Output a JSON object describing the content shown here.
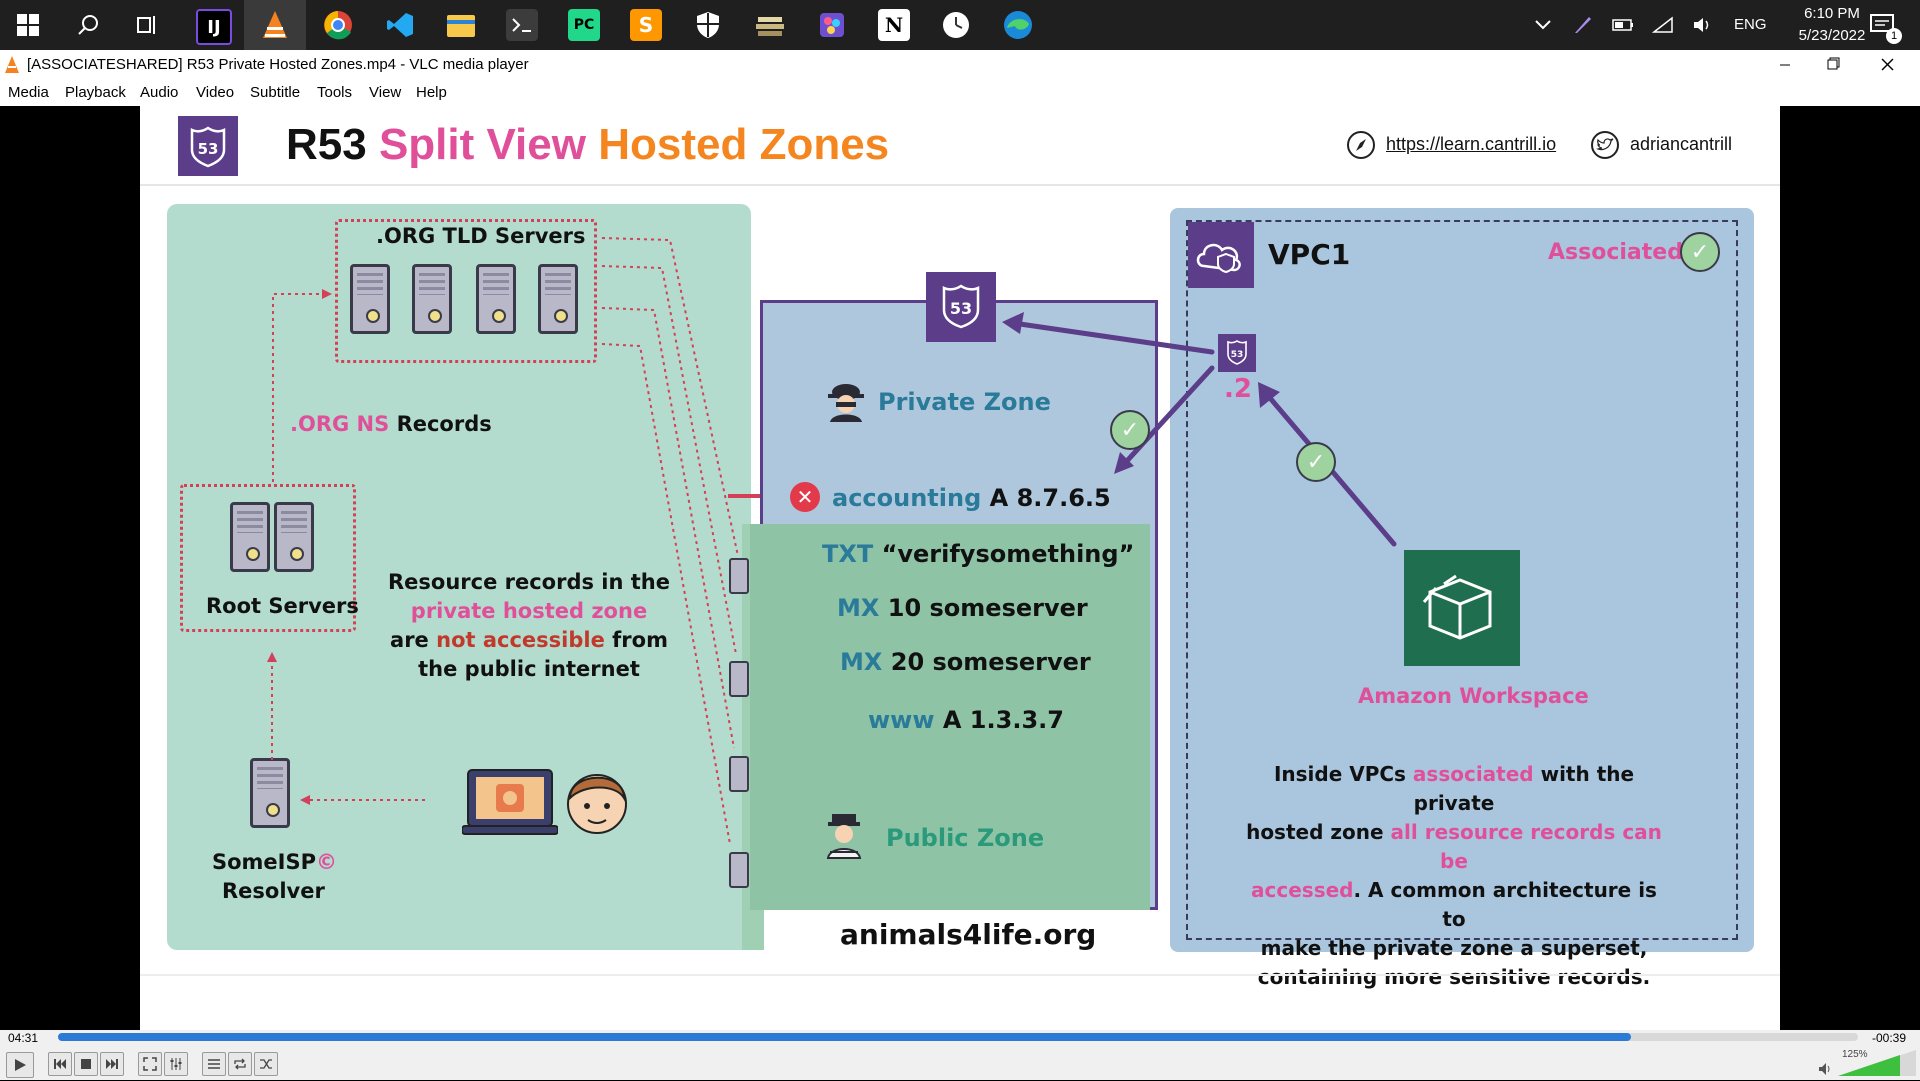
{
  "taskbar": {
    "icons": [
      "windows-start-icon",
      "search-icon",
      "task-view-icon",
      "intellij-icon",
      "vlc-icon",
      "chrome-icon",
      "vscode-icon",
      "file-explorer-icon",
      "terminal-icon",
      "pycharm-icon",
      "sublime-icon",
      "security-icon",
      "stack-icon",
      "paint-icon",
      "notion-icon",
      "clock-app-icon",
      "edge-icon"
    ],
    "language": "ENG",
    "time": "6:10 PM",
    "date": "5/23/2022",
    "notification_count": "1"
  },
  "window": {
    "title": "[ASSOCIATESHARED] R53 Private Hosted Zones.mp4 - VLC media player"
  },
  "menu": [
    "Media",
    "Playback",
    "Audio",
    "Video",
    "Subtitle",
    "Tools",
    "View",
    "Help"
  ],
  "slide": {
    "title_part1": "R53",
    "title_part2": "Split View",
    "title_part3": "Hosted Zones",
    "link": "https://learn.cantrill.io",
    "twitter": "adriancantrill",
    "org_tld": ".ORG TLD Servers",
    "org_ns_part1": ".ORG NS",
    "org_ns_part2": "Records",
    "root_servers": "Root Servers",
    "resolver_line1_a": "SomeISP",
    "resolver_line1_b": "©",
    "resolver_line2": "Resolver",
    "public_note": {
      "l1": "Resource records in the",
      "l2": "private hosted zone",
      "l3a": "are",
      "l3b": "not accessible",
      "l3c": "from",
      "l4": "the public internet"
    },
    "badge_53": "53",
    "private_zone": "Private Zone",
    "accounting_a": "accounting",
    "accounting_b": "A 8.7.6.5",
    "records": [
      {
        "type": "TXT",
        "value": "“verifysomething”"
      },
      {
        "type": "MX",
        "value": "10 someserver"
      },
      {
        "type": "MX",
        "value": "20 someserver"
      },
      {
        "type": "www",
        "value": "A 1.3.3.7"
      }
    ],
    "public_zone": "Public Zone",
    "domain": "animals4life.org",
    "vpc": "VPC1",
    "associated": "Associated",
    "dot2": ".2",
    "workspace": "Amazon Workspace",
    "vpc_note": {
      "l1a": "Inside VPCs",
      "l1b": "associated",
      "l1c": "with the private",
      "l2a": "hosted zone",
      "l2b": "all resource records can be",
      "l3a": "accessed",
      "l3b": ". A common architecture is to",
      "l4": "make the private zone a superset,",
      "l5": "containing more sensitive records."
    }
  },
  "player": {
    "elapsed": "04:31",
    "remaining": "-00:39",
    "progress": 0.874,
    "volume": "125%"
  },
  "colors": {
    "pink": "#e0509a",
    "orange": "#f5861f",
    "purple": "#5b3d8a",
    "teal_text": "#2a7a9a",
    "red": "#c0392b",
    "public_bg": "#b3dccf",
    "private_bg": "#aec7dc",
    "vpc_bg": "#a9c6de",
    "progress_blue": "#2b7ad6"
  }
}
